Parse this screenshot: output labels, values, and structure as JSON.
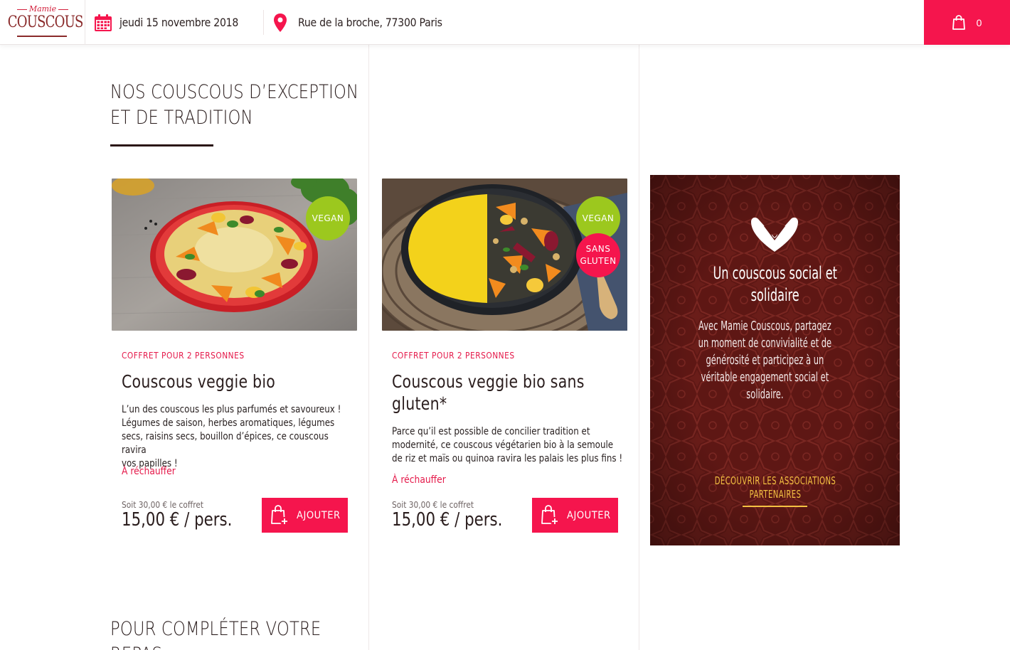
{
  "header": {
    "logo_script": "Mamie",
    "logo_word": "COUSCOUS",
    "date": "jeudi 15 novembre 2018",
    "address": "Rue de la broche, 77300 Paris",
    "cart_count": "0"
  },
  "section_title_1": [
    "NOS COUSCOUS D’EXCEPTION",
    "ET DE TRADITION"
  ],
  "products": [
    {
      "kicker": "COFFRET POUR 2 PERSONNES",
      "name": "Couscous veggie bio",
      "description": [
        "L’un des couscous les plus parfumés et savoureux !",
        "Légumes de saison, herbes aromatiques, légumes",
        "secs, raisins secs, bouillon d’épices, ce couscous ravira",
        "vos papilles !"
      ],
      "heat": "À réchauffer",
      "soit": "Soit 30,00 € le coffret",
      "price": "15,00 € / pers.",
      "button": "AJOUTER",
      "badges": [
        "VEGAN"
      ]
    },
    {
      "kicker": "COFFRET POUR 2 PERSONNES",
      "name_lines": [
        "Couscous veggie bio sans",
        "gluten*"
      ],
      "description": [
        "Parce qu’il est possible de concilier tradition et",
        "modernité, ce couscous végétarien bio à la semoule",
        "de riz et maïs ou quinoa ravira les palais les plus fins !"
      ],
      "heat": "À réchauffer",
      "soit": "Soit 30,00 € le coffret",
      "price": "15,00 € / pers.",
      "button": "AJOUTER",
      "badges": [
        "VEGAN",
        "SANS GLUTEN"
      ]
    }
  ],
  "promo": {
    "title": [
      "Un couscous social et",
      "solidaire"
    ],
    "text": [
      "Avec Mamie Couscous, partagez",
      "un moment de convivialité et de",
      "générosité et participez à un",
      "véritable engagement social et",
      "solidaire."
    ],
    "link": [
      "DÉCOUVRIR LES ASSOCIATIONS",
      "PARTENAIRES"
    ]
  },
  "section_title_2": [
    "POUR COMPLÉTER VOTRE",
    "REPAS"
  ],
  "colors": {
    "accent": "#f5154d",
    "vegan": "#9cc81e",
    "promo_bg": "#5e1714",
    "promo_link": "#f5c142",
    "text_dark": "#2a1d1d"
  },
  "icons": [
    "calendar-icon",
    "map-pin-icon",
    "shopping-bag-icon",
    "bag-plus-icon",
    "hands-heart-icon"
  ]
}
